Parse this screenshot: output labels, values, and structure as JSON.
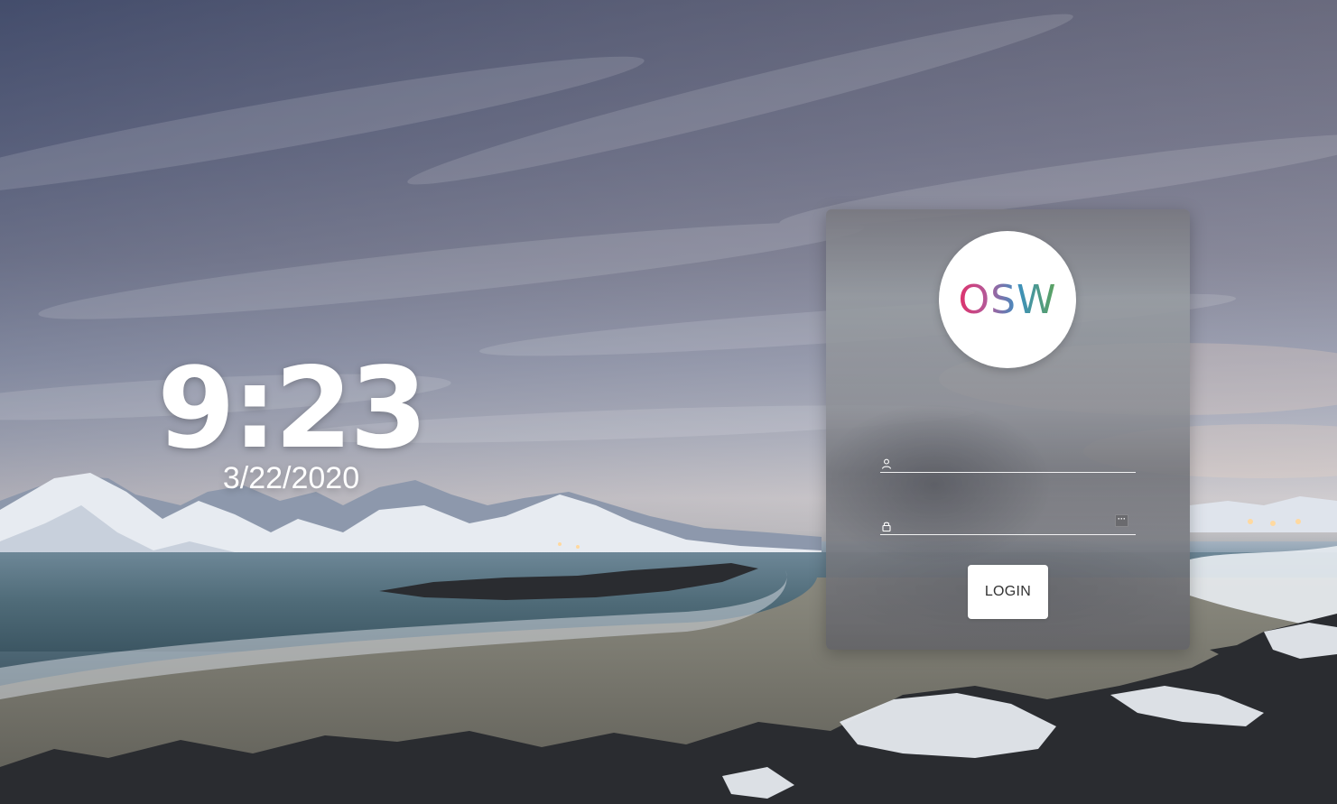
{
  "clock": {
    "time": "9:23",
    "date": "3/22/2020"
  },
  "login": {
    "logo_text": "OSW",
    "username": {
      "value": "",
      "placeholder": "",
      "icon": "user-icon"
    },
    "password": {
      "value": "",
      "placeholder": "",
      "icon": "lock-icon",
      "reveal_icon": "password-reveal-icon"
    },
    "button_label": "LOGIN"
  },
  "colors": {
    "logo_gradient": [
      "#e0306a",
      "#3c8fc0",
      "#5da35a"
    ],
    "panel_background": "#8a8c92",
    "button_background": "#ffffff"
  }
}
